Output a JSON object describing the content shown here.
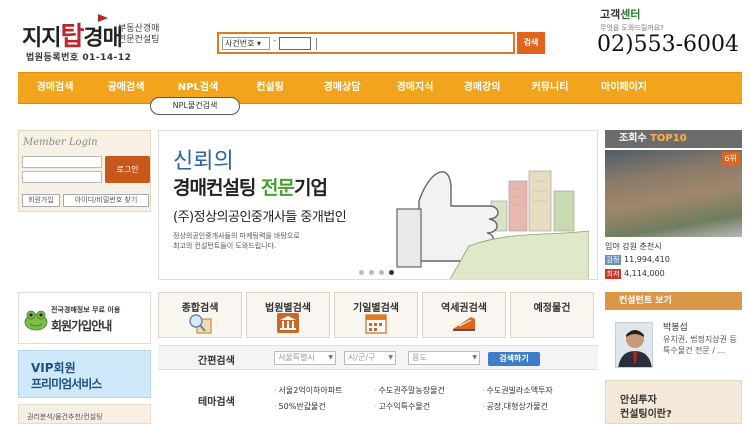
{
  "header": {
    "logo_main_1": "지지",
    "logo_main_big": "탑",
    "logo_main_2": "경매",
    "logo_side_1": "부동산경매",
    "logo_side_2": "전문컨설팅",
    "logo_sub": "법원등록번호 01-14-12",
    "search": {
      "select_value": "사건번호 ▾",
      "dash": "-",
      "button_label": "검색"
    },
    "cs_title_1": "고객",
    "cs_title_2": "센터",
    "cs_sub": "무엇을 도와드릴까요?",
    "phone": "02)553-6004"
  },
  "nav": {
    "items": [
      "경매검색",
      "공매검색",
      "NPL검색",
      "컨설팅",
      "경매상담",
      "경매지식",
      "경매강의",
      "커뮤니티",
      "마이페이지"
    ],
    "sub_item": "NPL물건검색"
  },
  "login": {
    "title": "Member Login",
    "login_button": "로그인",
    "join_button": "회원가입",
    "find_button": "아이디/비밀번호 찾기"
  },
  "banner": {
    "line1": "신뢰의",
    "line2_a": "경매컨설팅 ",
    "line2_b": "전문",
    "line2_c": "기업",
    "line3": "(주)정상의공인중개사들 중개법인",
    "desc1": "정상의공인중개사들의 마케팅력을 바탕으로",
    "desc2": "최고의 컨설턴트들이 도와드립니다."
  },
  "top10": {
    "head_a": "조회수 ",
    "head_b": "TOP10",
    "badge": "6위",
    "location": "임야 강원 춘천시",
    "row1_tag": "감정",
    "row1_value": "11,994,410",
    "row2_tag": "최저",
    "row2_value": "4,114,000",
    "colors": {
      "tag1": "#6e8fb8",
      "tag2": "#d0342c"
    }
  },
  "promo": {
    "join_small": "전국경매정보 무료 이용",
    "join_big": "회원가입안내",
    "vip_1": "VIP회원",
    "vip_2": "프리미엄서비스",
    "bottom": "권리분석/물건추천/컨설팅"
  },
  "tabs": [
    "종합검색",
    "법원별검색",
    "기일별검색",
    "역세권검색",
    "예정물건"
  ],
  "simple_search": {
    "label": "간편검색",
    "sel1": "서울특별시",
    "sel2": "시/군/구",
    "sel3": "용도",
    "button": "검색하기"
  },
  "theme": {
    "label": "테마검색",
    "links": [
      "서울2억이하아파트",
      "수도권주말농장물건",
      "수도권빌라소액투자",
      "50%반값물건",
      "고수익특수물건",
      "공장,대형상가물건"
    ]
  },
  "consultant": {
    "head": "컨설턴트 보기",
    "name": "박봉섭",
    "desc": "유치권, 법정지상권 등 특수물건 전문 / ..."
  },
  "safe": {
    "line1": "안심투자",
    "line2": "컨설팅이란?"
  }
}
